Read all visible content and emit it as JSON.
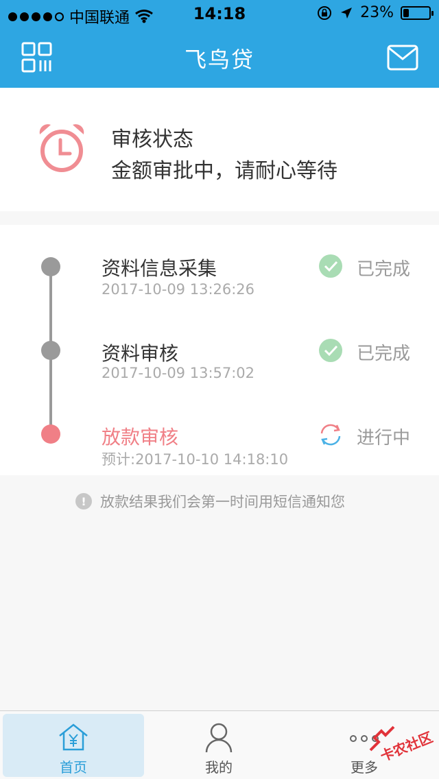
{
  "status_bar": {
    "carrier": "中国联通",
    "time": "14:18",
    "battery": "23%",
    "battery_level": 0.23
  },
  "nav": {
    "title": "飞鸟贷"
  },
  "review": {
    "title": "审核状态",
    "message": "金额审批中，请耐心等待"
  },
  "steps": [
    {
      "title": "资料信息采集",
      "time": "2017-10-09 13:26:26",
      "status": "已完成",
      "state": "done"
    },
    {
      "title": "资料审核",
      "time": "2017-10-09 13:57:02",
      "status": "已完成",
      "state": "done"
    },
    {
      "title": "放款审核",
      "time": "预计:2017-10-10 14:18:10",
      "status": "进行中",
      "state": "in-progress"
    }
  ],
  "notice": "放款结果我们会第一时间用短信通知您",
  "tabs": [
    {
      "label": "首页",
      "icon": "home-yen-icon",
      "active": true
    },
    {
      "label": "我的",
      "icon": "user-icon",
      "active": false
    },
    {
      "label": "更多",
      "icon": "more-dots-icon",
      "active": false
    }
  ],
  "watermark": "卡农社区",
  "colors": {
    "primary": "#2ea6e2",
    "accent": "#f07f86",
    "done": "#a9dcb4"
  }
}
